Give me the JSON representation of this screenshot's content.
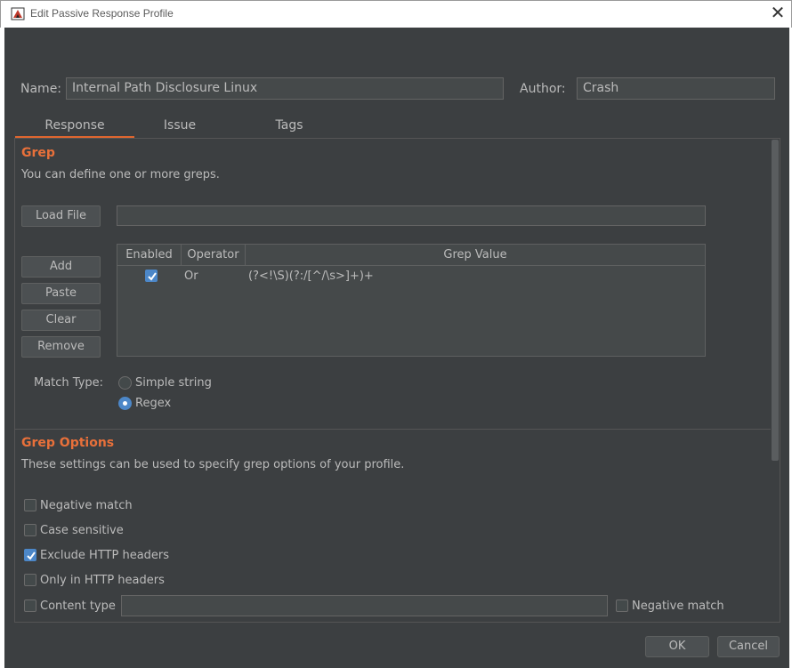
{
  "window": {
    "title": "Edit Passive Response Profile"
  },
  "profile": {
    "name_label": "Name:",
    "name_value": "Internal Path Disclosure Linux",
    "author_label": "Author:",
    "author_value": "Crash"
  },
  "tabs": [
    {
      "label": "Response",
      "active": true
    },
    {
      "label": "Issue",
      "active": false
    },
    {
      "label": "Tags",
      "active": false
    }
  ],
  "grep": {
    "title": "Grep",
    "description": "You can define one or more greps.",
    "load_file_label": "Load File",
    "load_file_value": "",
    "buttons": {
      "add": "Add",
      "paste": "Paste",
      "clear": "Clear",
      "remove": "Remove"
    },
    "table": {
      "columns": [
        "Enabled",
        "Operator",
        "Grep Value"
      ],
      "rows": [
        {
          "enabled": true,
          "operator": "Or",
          "value": "(?<!\\S)(?:/[^/\\s>]+)+"
        }
      ]
    },
    "match_type_label": "Match Type:",
    "match_types": [
      {
        "label": "Simple string",
        "selected": false
      },
      {
        "label": "Regex",
        "selected": true
      }
    ]
  },
  "grep_options": {
    "title": "Grep Options",
    "description": "These settings can be used to specify grep options of your profile.",
    "options": [
      {
        "label": "Negative match",
        "checked": false
      },
      {
        "label": "Case sensitive",
        "checked": false
      },
      {
        "label": "Exclude HTTP headers",
        "checked": true
      },
      {
        "label": "Only in HTTP headers",
        "checked": false
      },
      {
        "label": "Content type",
        "checked": false
      }
    ],
    "content_type_value": "",
    "content_type_negative_label": "Negative match",
    "content_type_negative_checked": false
  },
  "footer": {
    "ok_label": "OK",
    "cancel_label": "Cancel"
  },
  "colors": {
    "accent": "#e8703a",
    "checkbox_on": "#4c87c8",
    "background": "#3c3f41"
  }
}
